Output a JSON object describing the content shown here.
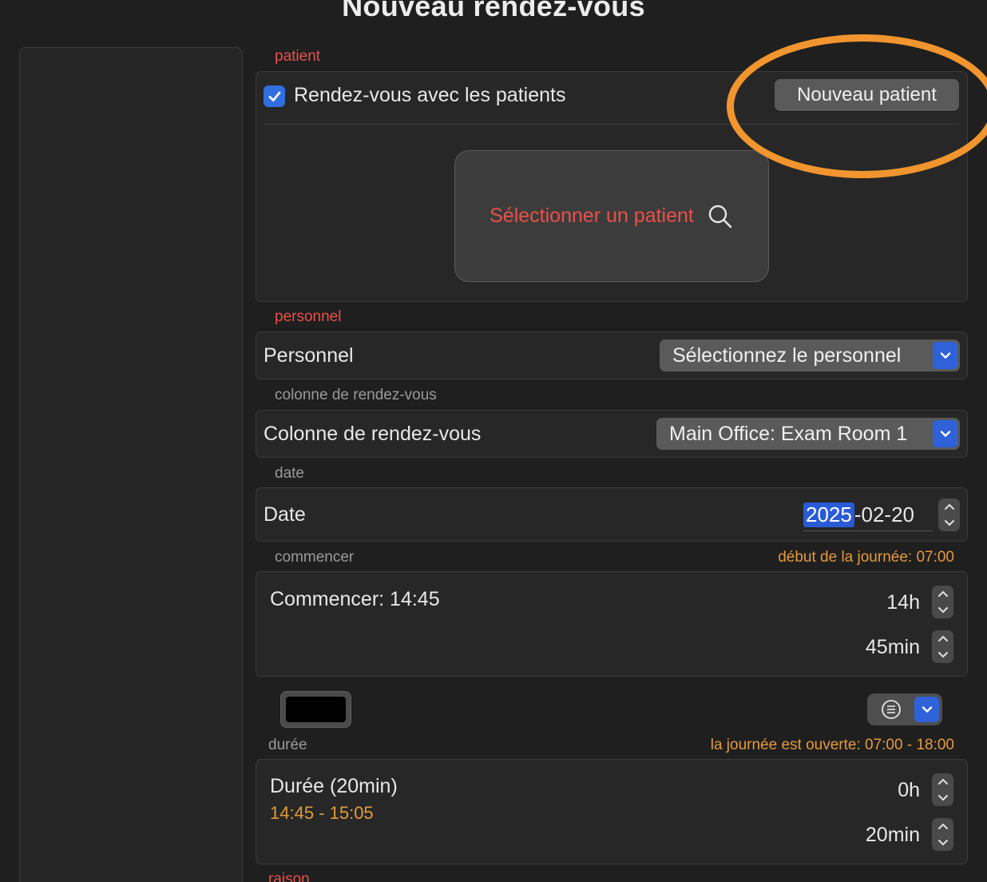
{
  "window": {
    "title": "Nouveau rendez-vous"
  },
  "patient": {
    "section_label": "patient",
    "checkbox_label": "Rendez-vous avec les patients",
    "checkbox_checked": true,
    "new_patient_button": "Nouveau patient",
    "select_patient": "Sélectionner un patient"
  },
  "personnel": {
    "section_label": "personnel",
    "label": "Personnel",
    "select_value": "Sélectionnez le personnel"
  },
  "column": {
    "section_label": "colonne de rendez-vous",
    "label": "Colonne de rendez-vous",
    "select_value": "Main Office: Exam Room 1"
  },
  "date": {
    "section_label": "date",
    "label": "Date",
    "year": "2025",
    "rest": "-02-20"
  },
  "start": {
    "section_label": "commencer",
    "hint": "début de la journée: 07:00",
    "label": "Commencer: 14:45",
    "hours": "14h",
    "minutes": "45min"
  },
  "duration": {
    "section_label": "durée",
    "hint": "la journée est ouverte: 07:00 - 18:00",
    "label": "Durée (20min)",
    "range": "14:45 - 15:05",
    "hours": "0h",
    "minutes": "20min"
  },
  "reason": {
    "section_label": "raison"
  },
  "colors": {
    "accent_blue": "#2f62d8",
    "red_label": "#e8514a",
    "orange_hint": "#e59a3a",
    "annotation_ring": "#f2952f"
  }
}
